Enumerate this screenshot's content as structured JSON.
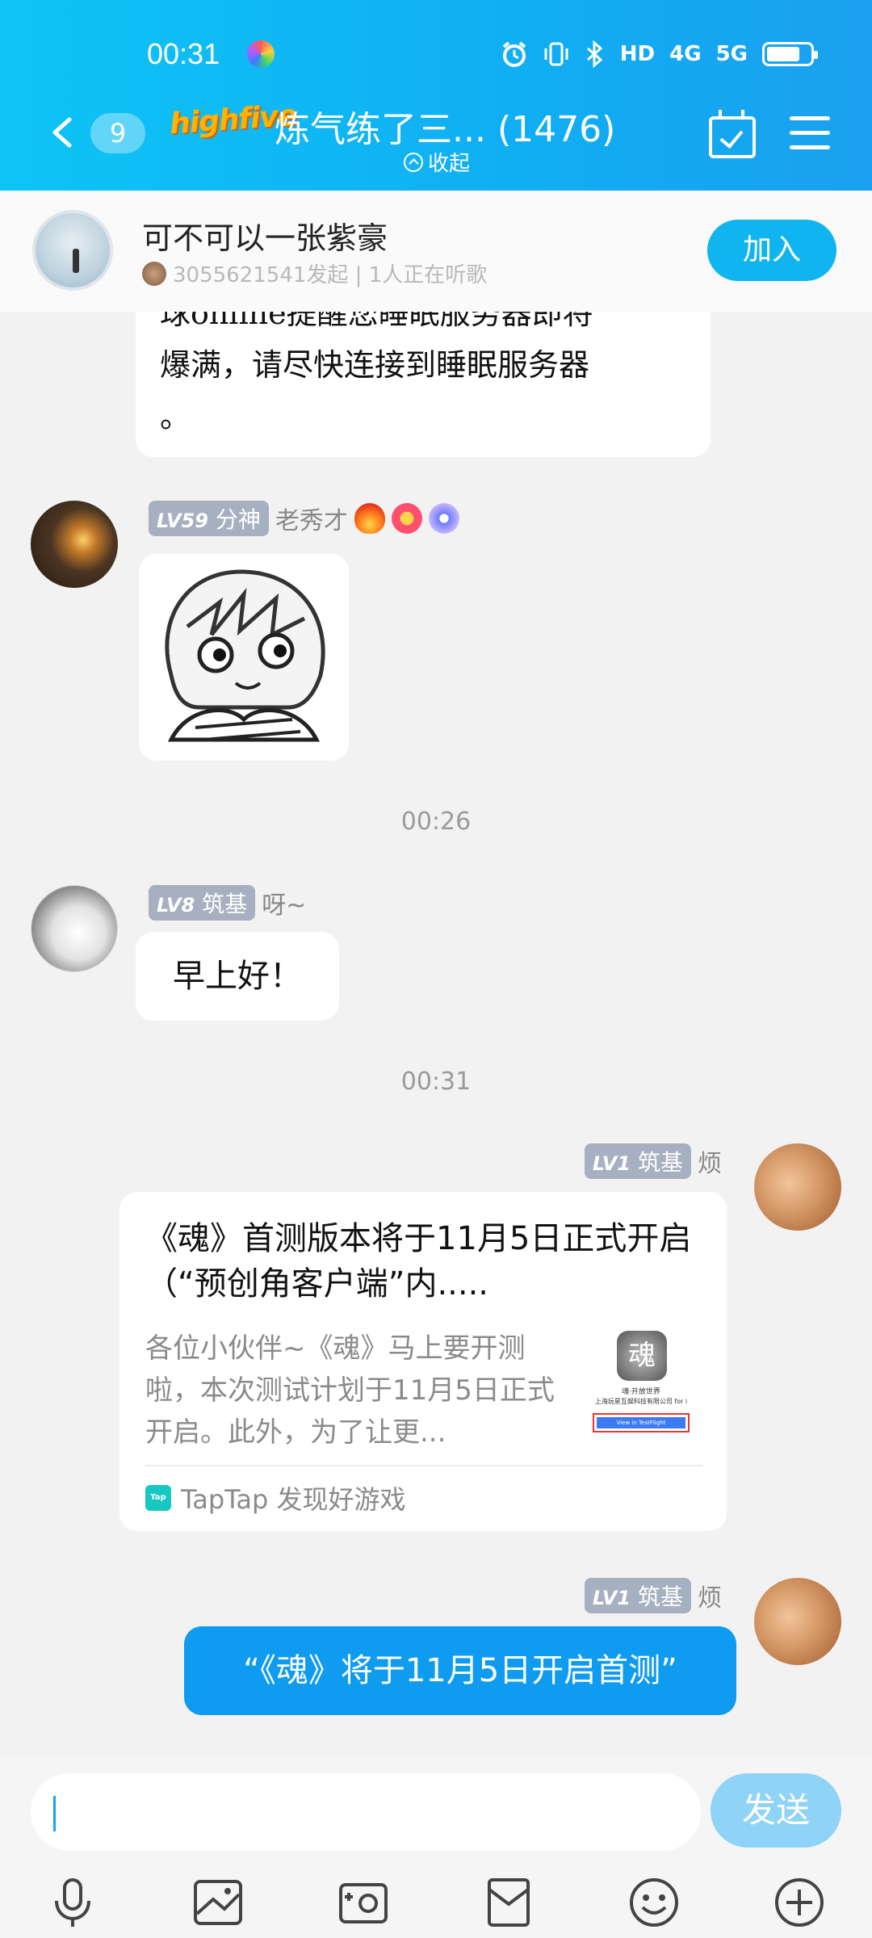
{
  "status_bar": {
    "time": "00:31",
    "icons": [
      "alarm-icon",
      "vibrate-icon",
      "bluetooth-icon",
      "hd-icon",
      "signal-4g-icon",
      "signal-5g-icon",
      "battery-icon"
    ],
    "hd_label": "HD",
    "net1": "4G",
    "net2": "5G"
  },
  "header": {
    "back_count": "9",
    "logo_text": "highfive",
    "title": "炼气练了三...  (1476)",
    "collapse_label": "收起"
  },
  "listen_banner": {
    "title": "可不可以一张紫豪",
    "subtitle": "3055621541发起 | 1人正在听歌",
    "join_label": "加入"
  },
  "messages": [
    {
      "type": "text_partial",
      "lines": [
        "球online提醒您睡眠服务器即将",
        "爆满，请尽快连接到睡眠服务器",
        "。"
      ]
    },
    {
      "type": "sticker",
      "level": "LV59",
      "rank": "分神",
      "name": "老秀才"
    },
    {
      "type": "time",
      "text": "00:26"
    },
    {
      "type": "text",
      "level": "LV8",
      "rank": "筑基",
      "name": "呀~",
      "text": "早上好！"
    },
    {
      "type": "time",
      "text": "00:31"
    },
    {
      "type": "card",
      "level": "LV1",
      "rank": "筑基",
      "name": "烦",
      "title": "《魂》首测版本将于11月5日正式开启（“预创角客户端”内.....",
      "description": "各位小伙伴~《魂》马上要开测啦，本次测试计划于11月5日正式开启。此外，为了让更...",
      "thumb_caption": "魂·开放世界",
      "thumb_company": "上海玩星互娱科技有限公司 for i",
      "thumb_button": "View in TestFlight",
      "source": "TapTap 发现好游戏",
      "source_badge": "Tap"
    },
    {
      "type": "text_self",
      "level": "LV1",
      "rank": "筑基",
      "name": "烦",
      "text": "“《魂》将于11月5日开启首测”"
    }
  ],
  "input": {
    "placeholder": "",
    "send_label": "发送"
  },
  "toolbar": [
    "microphone-icon",
    "image-icon",
    "camera-icon",
    "red-packet-icon",
    "emoji-icon",
    "plus-icon"
  ],
  "colors": {
    "header_gradient_start": "#0ec4f5",
    "header_gradient_end": "#1aa0f0",
    "accent": "#10b4ef",
    "self_bubble": "#0f9bf0",
    "level_badge": "#a6b0c0"
  }
}
